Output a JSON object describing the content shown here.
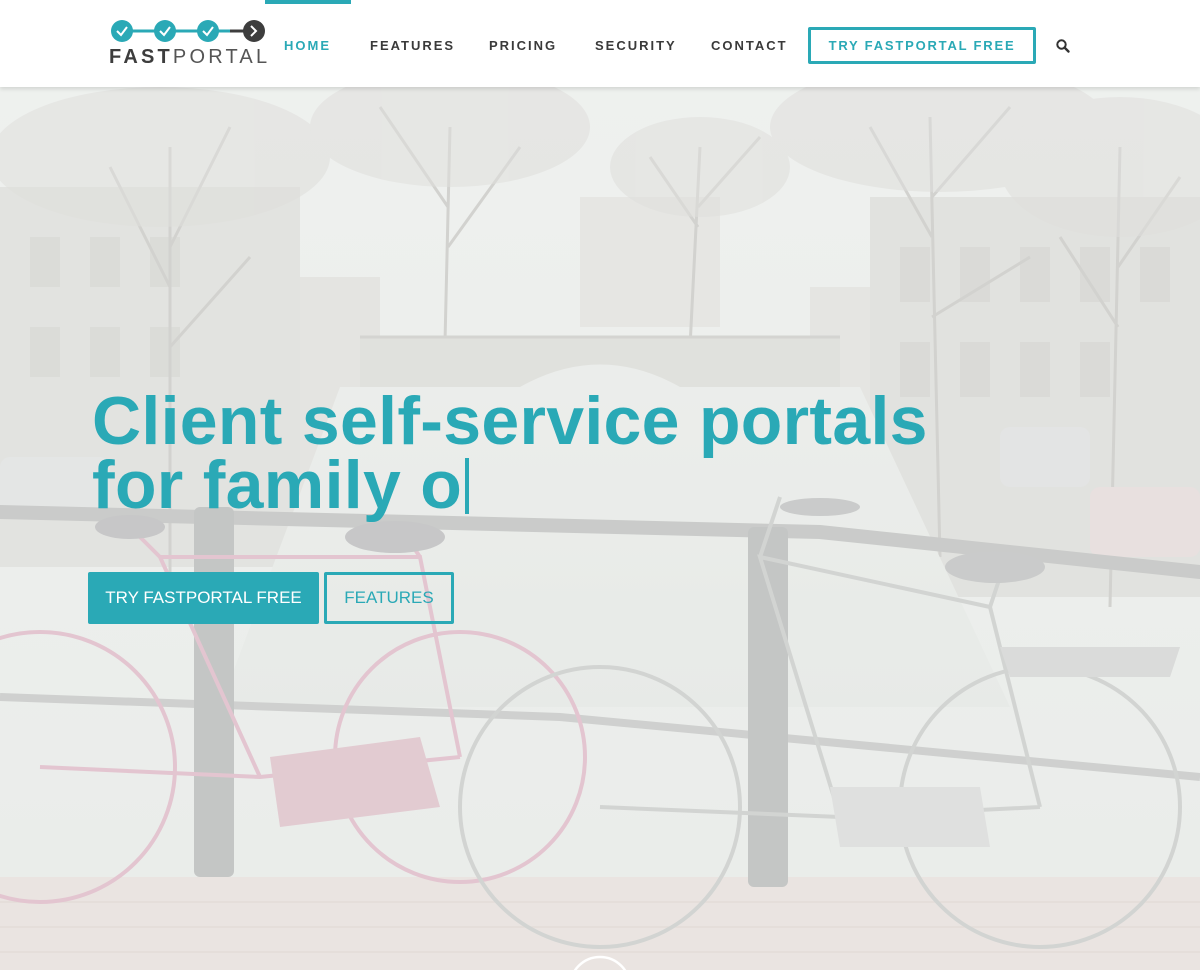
{
  "brand": {
    "name_bold": "FAST",
    "name_light": "PORTAL",
    "accent_color": "#2aa9b6",
    "dark_color": "#3d3d3d"
  },
  "nav": {
    "items": [
      {
        "label": "HOME",
        "active": true
      },
      {
        "label": "FEATURES",
        "active": false
      },
      {
        "label": "PRICING",
        "active": false
      },
      {
        "label": "SECURITY",
        "active": false
      },
      {
        "label": "CONTACT",
        "active": false
      }
    ],
    "cta_label": "TRY FASTPORTAL FREE",
    "search_icon": "search-icon"
  },
  "hero": {
    "title_line1": "Client self-service portals",
    "title_line2": "for family o",
    "primary_button": "TRY FASTPORTAL FREE",
    "secondary_button": "FEATURES",
    "background": "faded photo of bicycles parked on a canal bridge railing"
  }
}
